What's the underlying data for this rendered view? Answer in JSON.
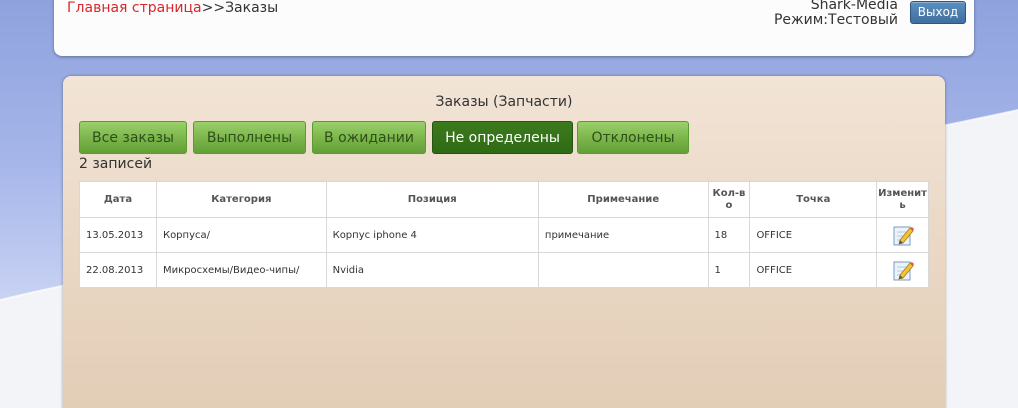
{
  "header": {
    "breadcrumb_home": "Главная страница",
    "breadcrumb_sep": ">>",
    "breadcrumb_current": "Заказы",
    "company": "Shark-Media",
    "mode": "Режим:Тестовый",
    "logout_label": "Выход"
  },
  "panel": {
    "title": "Заказы (Запчасти)",
    "tabs": [
      {
        "label": "Все заказы",
        "active": false
      },
      {
        "label": "Выполнены",
        "active": false
      },
      {
        "label": "В ожидании",
        "active": false
      },
      {
        "label": "Не определены",
        "active": true
      },
      {
        "label": "Отклонены",
        "active": false
      }
    ],
    "record_count": "2 записей"
  },
  "table": {
    "columns": [
      "Дата",
      "Категория",
      "Позиция",
      "Примечание",
      "Кол-в о",
      "Точка",
      "Изменит ь"
    ],
    "rows": [
      {
        "date": "13.05.2013",
        "category": "Корпуса/",
        "position": "Корпус iphone 4",
        "note": "примечание",
        "qty": "18",
        "point": "OFFICE",
        "edit_icon": "edit-pencil-icon"
      },
      {
        "date": "22.08.2013",
        "category": "Микросхемы/Видео-чипы/",
        "position": "Nvidia",
        "note": "",
        "qty": "1",
        "point": "OFFICE",
        "edit_icon": "edit-pencil-icon"
      }
    ]
  },
  "colors": {
    "breadcrumb_link": "#d8272c",
    "tab_green": "#7ab44a",
    "tab_active": "#2f6a14",
    "logout_blue": "#3f6f9f"
  }
}
